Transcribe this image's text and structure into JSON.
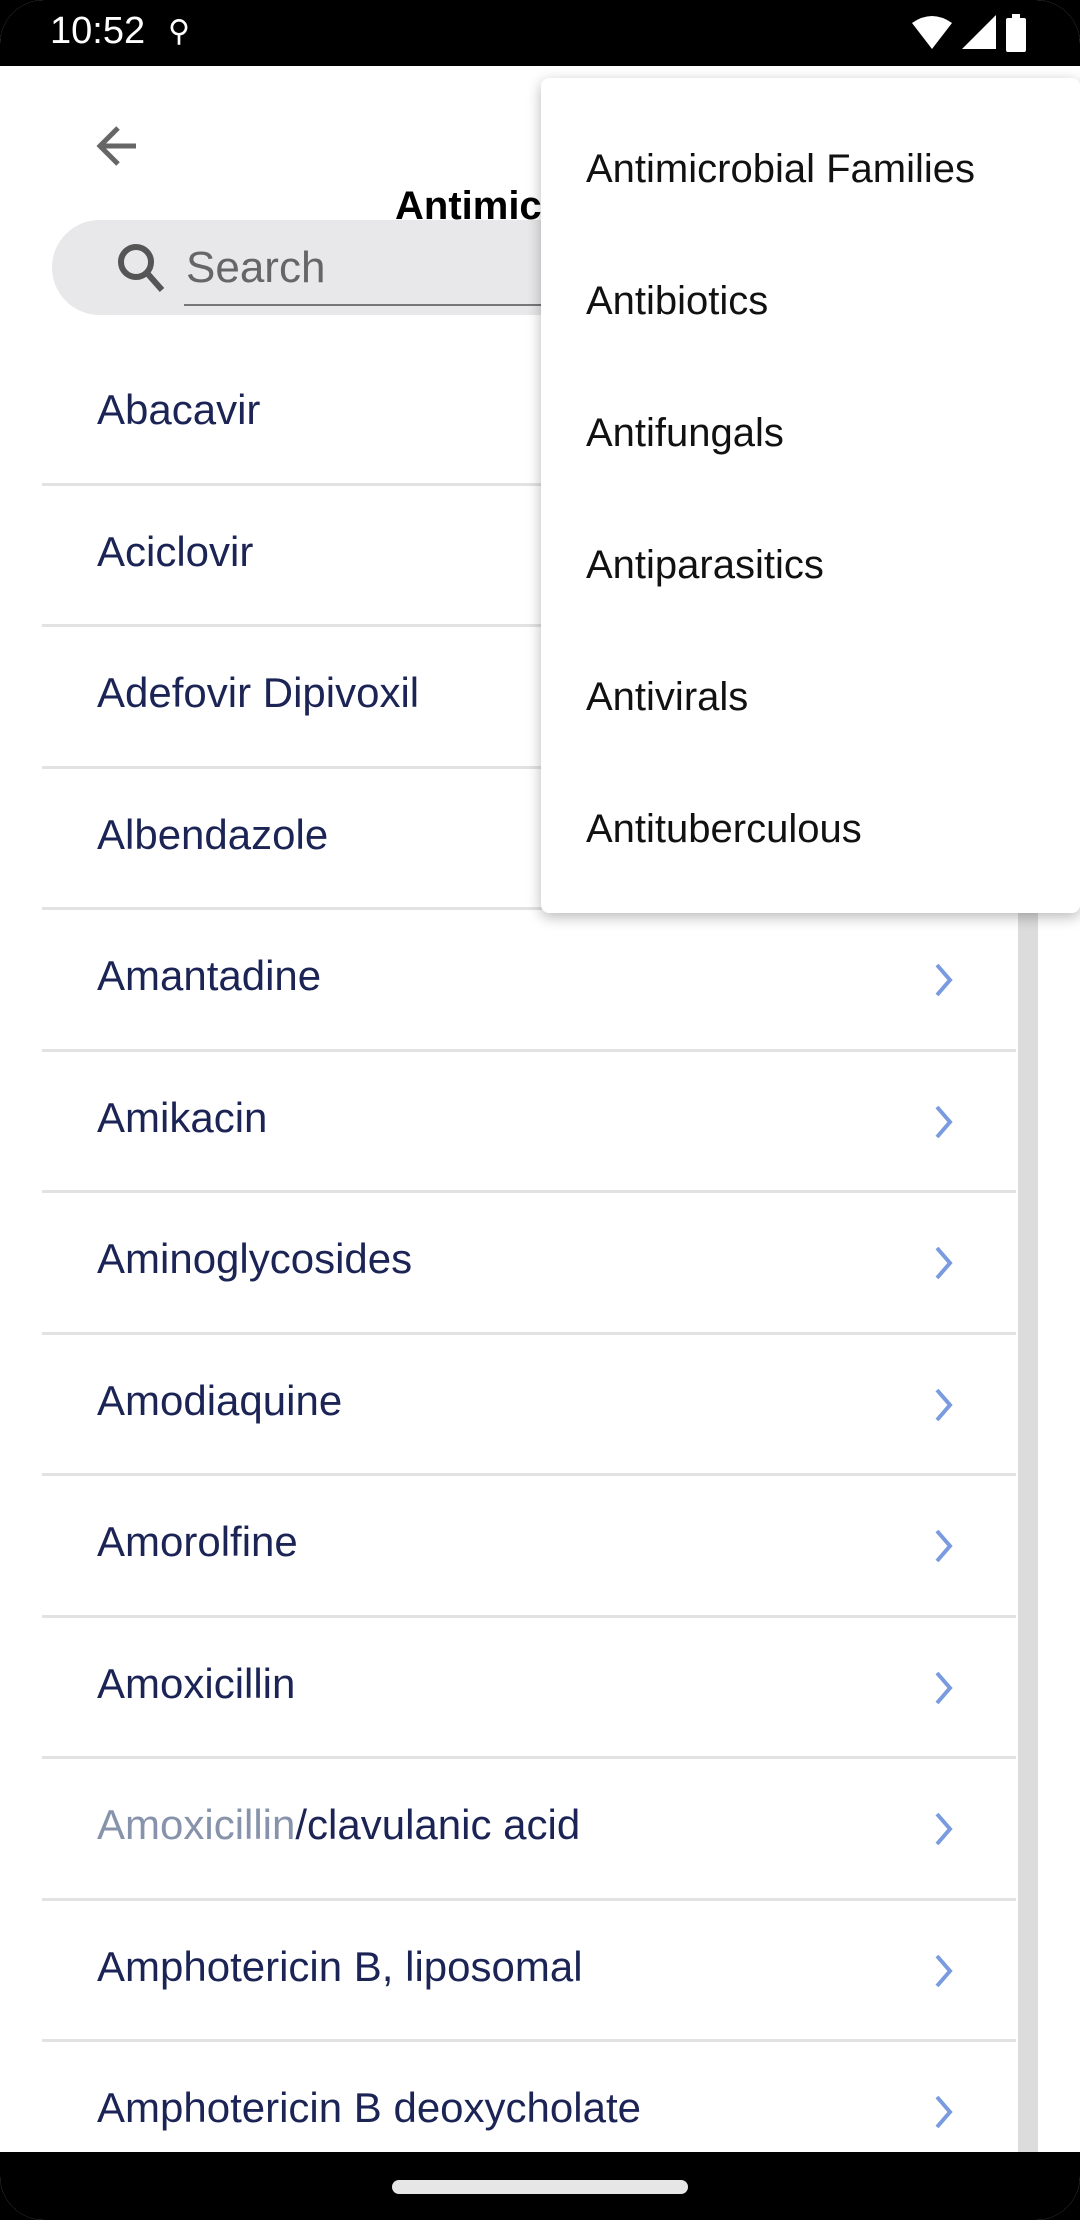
{
  "status_bar": {
    "time": "10:52"
  },
  "header": {
    "title": "Antimicrobials"
  },
  "search": {
    "placeholder": "Search"
  },
  "list": {
    "items": [
      {
        "label": "Abacavir"
      },
      {
        "label": "Aciclovir"
      },
      {
        "label": "Adefovir Dipivoxil"
      },
      {
        "label": "Albendazole"
      },
      {
        "label": "Amantadine"
      },
      {
        "label": "Amikacin"
      },
      {
        "label": "Aminoglycosides"
      },
      {
        "label": "Amodiaquine"
      },
      {
        "label": "Amorolfine"
      },
      {
        "label": "Amoxicillin"
      },
      {
        "label_dim": "Amoxicillin",
        "label": "/clavulanic acid"
      },
      {
        "label": "Amphotericin B, liposomal"
      },
      {
        "label": "Amphotericin B deoxycholate"
      }
    ]
  },
  "menu": {
    "items": [
      "Antimicrobial Families",
      "Antibiotics",
      "Antifungals",
      "Antiparasitics",
      "Antivirals",
      "Antituberculous"
    ]
  },
  "colors": {
    "text": "#1b2455",
    "chevron": "#7b9be0",
    "dim": "#8793ab"
  }
}
